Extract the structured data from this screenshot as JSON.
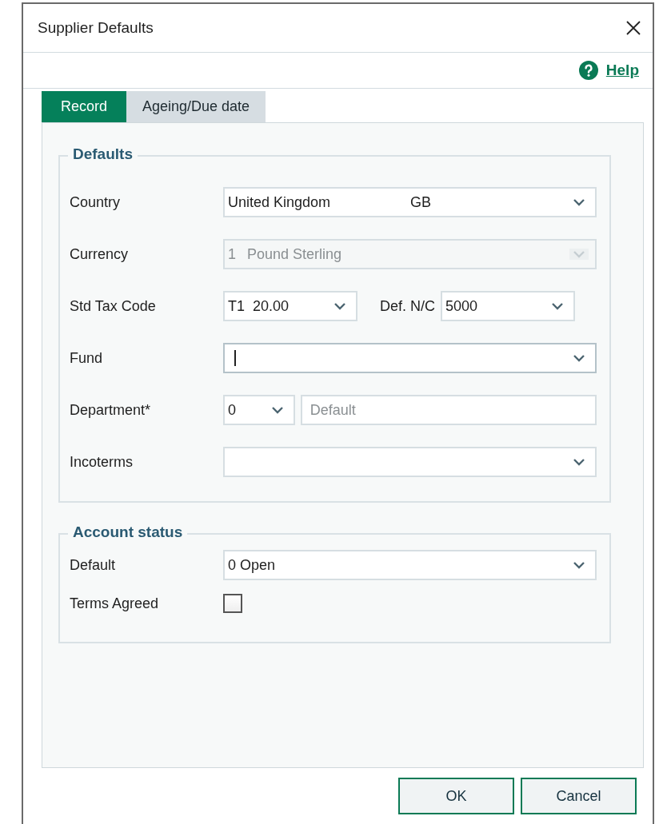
{
  "window": {
    "title": "Supplier Defaults"
  },
  "help": {
    "label": "Help"
  },
  "tabs": [
    {
      "label": "Record",
      "selected": true
    },
    {
      "label": "Ageing/Due date",
      "selected": false
    }
  ],
  "defaults": {
    "title": "Defaults",
    "rows": [
      {
        "kind": "combo",
        "label": "Country",
        "value": "United Kingdom",
        "suffix": "GB",
        "disabled": false,
        "focused": false
      },
      {
        "kind": "combo",
        "label": "Currency",
        "prefix": "1",
        "value": "Pound Sterling",
        "disabled": true,
        "focused": false
      },
      {
        "kind": "pair",
        "label": "Std Tax Code",
        "value": "T1  20.00",
        "label_2": "Def. N/C",
        "value_2": "5000",
        "disabled": false,
        "focused": false
      },
      {
        "kind": "combo",
        "label": "Fund",
        "disabled": false,
        "focused": true
      },
      {
        "kind": "department",
        "label": "Department*",
        "value": "0",
        "placeholder": "Default",
        "disabled": false,
        "focused": false
      },
      {
        "kind": "combo",
        "label": "Incoterms",
        "disabled": false,
        "focused": false
      }
    ]
  },
  "account_status": {
    "title": "Account status",
    "rows": [
      {
        "kind": "combo",
        "label": "Default",
        "value": "0 Open"
      },
      {
        "kind": "checkbox",
        "label": "Terms Agreed",
        "checked": false
      }
    ]
  },
  "buttons": [
    {
      "label": "OK"
    },
    {
      "label": "Cancel"
    }
  ]
}
